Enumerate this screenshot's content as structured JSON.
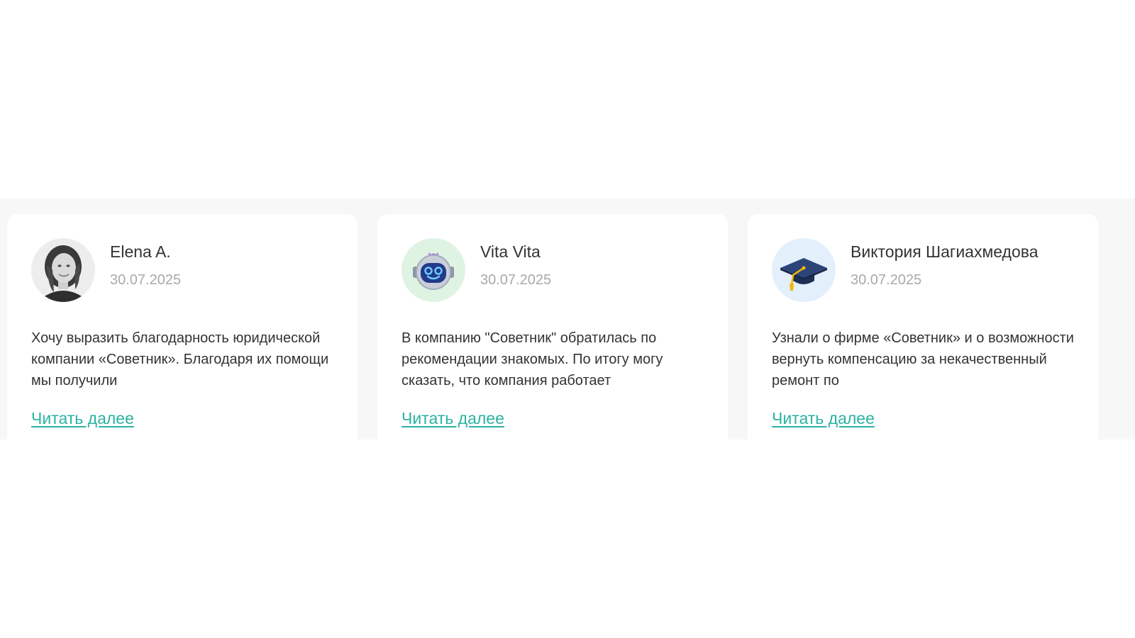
{
  "reviews": [
    {
      "name": "Elena A.",
      "date": "30.07.2025",
      "text": "Хочу выразить благодарность юридической компании «Советник». Благодаря их помощи мы получили",
      "read_more": "Читать далее",
      "avatar": "photo-portrait",
      "avatar_bg": "#e6e6e6"
    },
    {
      "name": "Vita Vita",
      "date": "30.07.2025",
      "text": "В компанию \"Советник\" обратилась по рекомендации знакомых. По итогу могу сказать, что компания работает",
      "read_more": "Читать далее",
      "avatar": "robot-icon",
      "avatar_bg": "#dff3e3"
    },
    {
      "name": "Виктория Шагиахмедова",
      "date": "30.07.2025",
      "text": "Узнали о фирме «Советник» и о возможности вернуть компенсацию за некачественный ремонт по",
      "read_more": "Читать далее",
      "avatar": "graduation-cap-icon",
      "avatar_bg": "#e3f0fb"
    }
  ],
  "colors": {
    "accent": "#2bb3a3",
    "strip_bg": "#f7f7f7",
    "card_bg": "#ffffff",
    "name": "#333333",
    "date": "#a9a9a9"
  }
}
